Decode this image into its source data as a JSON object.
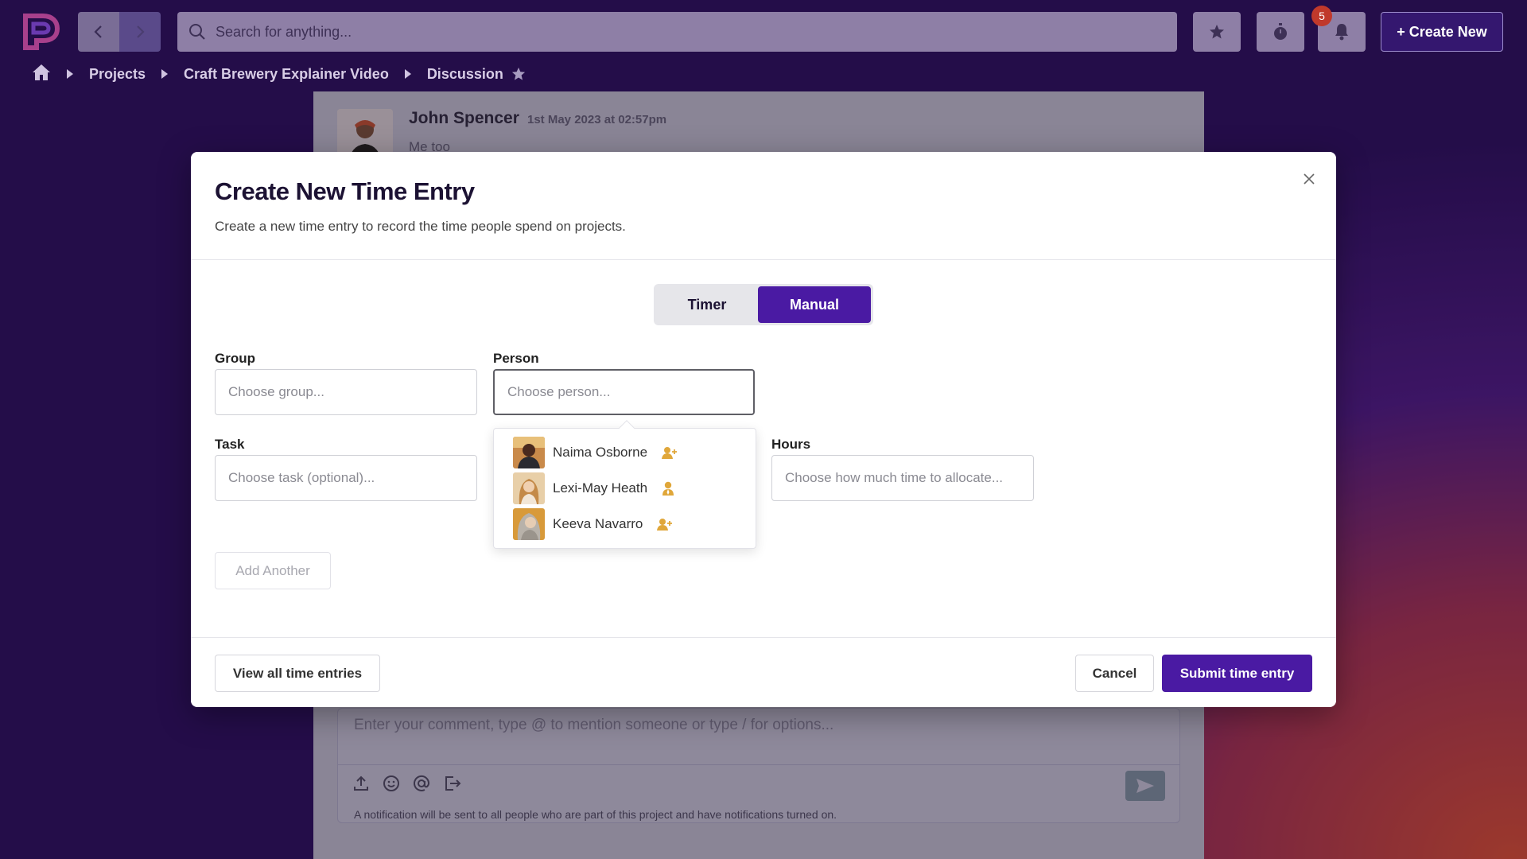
{
  "header": {
    "search_placeholder": "Search for anything...",
    "notification_count": "5",
    "create_new_label": "+ Create New"
  },
  "breadcrumb": {
    "items": [
      "Projects",
      "Craft Brewery Explainer Video",
      "Discussion"
    ]
  },
  "background_page": {
    "comment": {
      "author": "John Spencer",
      "date": "1st May 2023 at 02:57pm",
      "body": "Me too"
    },
    "composer": {
      "placeholder": "Enter your comment, type @ to mention someone or type / for options...",
      "note": "A notification will be sent to all people who are part of this project and have notifications turned on."
    }
  },
  "modal": {
    "title": "Create New Time Entry",
    "subtitle": "Create a new time entry to record the time people spend on projects.",
    "mode_toggle": {
      "options": [
        "Timer",
        "Manual"
      ],
      "selected": "Manual"
    },
    "fields": {
      "group": {
        "label": "Group",
        "placeholder": "Choose group..."
      },
      "person": {
        "label": "Person",
        "placeholder": "Choose person..."
      },
      "task": {
        "label": "Task",
        "placeholder": "Choose task (optional)..."
      },
      "hours": {
        "label": "Hours",
        "placeholder": "Choose how much time to allocate..."
      }
    },
    "person_options": [
      {
        "name": "Naima Osborne",
        "role_icon": "user-plus-icon"
      },
      {
        "name": "Lexi-May Heath",
        "role_icon": "user-tie-icon"
      },
      {
        "name": "Keeva Navarro",
        "role_icon": "user-plus-icon"
      }
    ],
    "add_another_label": "Add Another",
    "footer": {
      "view_all_label": "View all time entries",
      "cancel_label": "Cancel",
      "submit_label": "Submit time entry"
    }
  },
  "colors": {
    "brand_primary": "#4a1aa3",
    "role_icon": "#e0a73a",
    "badge": "#c0392b"
  }
}
